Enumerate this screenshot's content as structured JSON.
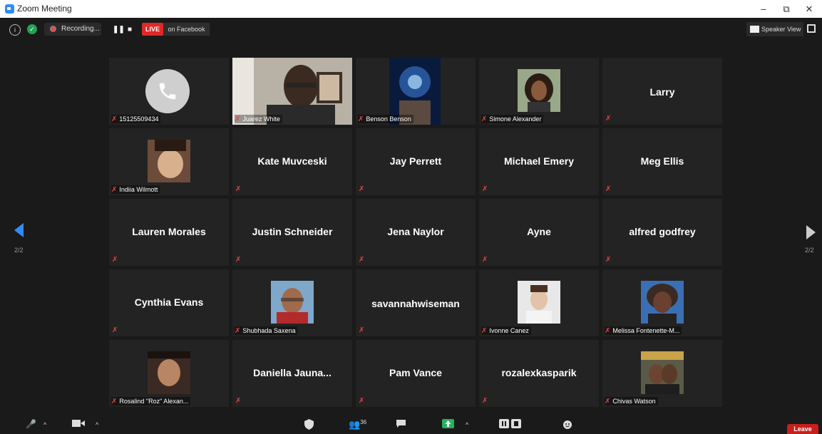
{
  "window": {
    "title": "Zoom Meeting",
    "min": "–",
    "restore": "⧉",
    "close": "✕"
  },
  "topbar": {
    "info": "i",
    "recording_label": "Recording...",
    "pause": "❚❚",
    "stop": "■",
    "live_label": "LIVE",
    "live_sub": "on Facebook",
    "speaker_view": "Speaker View"
  },
  "nav": {
    "page_left": "2/2",
    "page_right": "2/2"
  },
  "participants": [
    {
      "display": "",
      "label": "15125509434",
      "type": "phone"
    },
    {
      "display": "",
      "label": "Juarez White",
      "type": "video"
    },
    {
      "display": "",
      "label": "Benson Benson",
      "type": "photo"
    },
    {
      "display": "",
      "label": "Simone Alexander",
      "type": "photo"
    },
    {
      "display": "Larry",
      "label": "",
      "type": "name"
    },
    {
      "display": "",
      "label": "Indiia Wilmott",
      "type": "photo"
    },
    {
      "display": "Kate Muvceski",
      "label": "",
      "type": "name"
    },
    {
      "display": "Jay Perrett",
      "label": "",
      "type": "name"
    },
    {
      "display": "Michael Emery",
      "label": "",
      "type": "name"
    },
    {
      "display": "Meg Ellis",
      "label": "",
      "type": "name"
    },
    {
      "display": "Lauren Morales",
      "label": "",
      "type": "name"
    },
    {
      "display": "Justin Schneider",
      "label": "",
      "type": "name"
    },
    {
      "display": "Jena Naylor",
      "label": "",
      "type": "name"
    },
    {
      "display": "Ayne",
      "label": "",
      "type": "name"
    },
    {
      "display": "alfred godfrey",
      "label": "",
      "type": "name"
    },
    {
      "display": "Cynthia Evans",
      "label": "",
      "type": "name"
    },
    {
      "display": "",
      "label": "Shubhada Saxena",
      "type": "photo"
    },
    {
      "display": "savannahwiseman",
      "label": "",
      "type": "name"
    },
    {
      "display": "",
      "label": "Ivonne Canez",
      "type": "photo"
    },
    {
      "display": "",
      "label": "Melissa Fontenette-M...",
      "type": "photo"
    },
    {
      "display": "",
      "label": "Rosalind \"Roz\" Alexan...",
      "type": "photo"
    },
    {
      "display": "Daniella  Jauna...",
      "label": "",
      "type": "name"
    },
    {
      "display": "Pam Vance",
      "label": "",
      "type": "name"
    },
    {
      "display": "rozalexkasparik",
      "label": "",
      "type": "name"
    },
    {
      "display": "",
      "label": "Chivas Watson",
      "type": "photo"
    }
  ],
  "bottombar": {
    "participant_count": "36",
    "leave": "Leave"
  }
}
